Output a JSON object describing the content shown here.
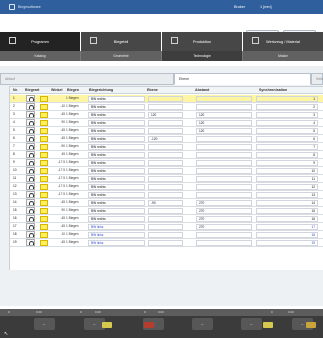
{
  "title": {
    "brand": "Biegesoftware",
    "user": "Bruker",
    "mode": "1 [mm]"
  },
  "modules": [
    {
      "label": "Programm",
      "icon": "program-icon",
      "active": true
    },
    {
      "label": "Biegeteil",
      "icon": "part-icon",
      "active": false
    },
    {
      "label": "Produktion",
      "icon": "production-icon",
      "active": false
    },
    {
      "label": "Werkzeug / Material",
      "icon": "tool-icon",
      "active": false
    }
  ],
  "subtabs": [
    {
      "label": "Katalog",
      "active": false
    },
    {
      "label": "Geometrie",
      "active": false
    },
    {
      "label": "Technologie",
      "active": true
    },
    {
      "label": "Maske",
      "active": false
    }
  ],
  "viewtabs": {
    "left": "Ablauf",
    "middle": "Ebene",
    "right": "Seite"
  },
  "table": {
    "headers": [
      "Nr.",
      "Biegeart",
      "Winkel",
      "Biegen",
      "Biegerichtung",
      "Ebene",
      "Abstand",
      "Synchronisation"
    ],
    "rows": [
      {
        "no": "1",
        "small": "",
        "form": "1 Biegen",
        "edge": "BW rechts",
        "ebene": "",
        "abstand": "",
        "sync": "1",
        "selected": true
      },
      {
        "no": "2",
        "small": "-10",
        "form": "1 Biegen",
        "edge": "BW rechts",
        "ebene": "",
        "abstand": "",
        "sync": "2",
        "selected": false
      },
      {
        "no": "3",
        "small": "-45",
        "form": "1 Biegen",
        "edge": "BW rechts",
        "ebene": "120",
        "abstand": "120",
        "sync": "3",
        "selected": false
      },
      {
        "no": "4",
        "small": "90",
        "form": "1 Biegen",
        "edge": "BW rechts",
        "ebene": "",
        "abstand": "120",
        "sync": "4",
        "selected": false
      },
      {
        "no": "5",
        "small": "-45",
        "form": "1 Biegen",
        "edge": "BW rechts",
        "ebene": "",
        "abstand": "120",
        "sync": "5",
        "selected": false
      },
      {
        "no": "6",
        "small": "-45",
        "form": "1 Biegen",
        "edge": "BW rechts",
        "ebene": "-120",
        "abstand": "",
        "sync": "6",
        "selected": false
      },
      {
        "no": "7",
        "small": "-90",
        "form": "1 Biegen",
        "edge": "BW rechts",
        "ebene": "",
        "abstand": "",
        "sync": "7",
        "selected": false
      },
      {
        "no": "8",
        "small": "45",
        "form": "1 Biegen",
        "edge": "BW rechts",
        "ebene": "",
        "abstand": "",
        "sync": "8",
        "selected": false
      },
      {
        "no": "9",
        "small": "-17.5",
        "form": "1 Biegen",
        "edge": "BW rechts",
        "ebene": "",
        "abstand": "",
        "sync": "9",
        "selected": false
      },
      {
        "no": "10",
        "small": "-17.5",
        "form": "1 Biegen",
        "edge": "BW rechts",
        "ebene": "",
        "abstand": "",
        "sync": "10",
        "selected": false
      },
      {
        "no": "11",
        "small": "-17.5",
        "form": "1 Biegen",
        "edge": "BW rechts",
        "ebene": "",
        "abstand": "",
        "sync": "11",
        "selected": false
      },
      {
        "no": "12",
        "small": "-17.5",
        "form": "1 Biegen",
        "edge": "BW rechts",
        "ebene": "",
        "abstand": "",
        "sync": "12",
        "selected": false
      },
      {
        "no": "13",
        "small": "-17.5",
        "form": "1 Biegen",
        "edge": "BW rechts",
        "ebene": "",
        "abstand": "",
        "sync": "13",
        "selected": false
      },
      {
        "no": "14",
        "small": "-45",
        "form": "1 Biegen",
        "edge": "BW rechts",
        "ebene": "-90",
        "abstand": "270",
        "sync": "14",
        "selected": false
      },
      {
        "no": "15",
        "small": "90",
        "form": "1 Biegen",
        "edge": "BW rechts",
        "ebene": "",
        "abstand": "270",
        "sync": "15",
        "selected": false
      },
      {
        "no": "16",
        "small": "-45",
        "form": "1 Biegen",
        "edge": "BW rechts",
        "ebene": "",
        "abstand": "270",
        "sync": "16",
        "selected": false
      },
      {
        "no": "17",
        "small": "-45",
        "form": "1 Biegen",
        "edge": "BW links",
        "ebene": "",
        "abstand": "270",
        "sync": "17",
        "selected": false
      },
      {
        "no": "18",
        "small": "10",
        "form": "1 Biegen",
        "edge": "BW links",
        "ebene": "",
        "abstand": "",
        "sync": "18",
        "selected": false
      },
      {
        "no": "19",
        "small": "-45",
        "form": "1 Biegen",
        "edge": "BW links",
        "ebene": "",
        "abstand": "",
        "sync": "19",
        "selected": false
      }
    ]
  },
  "status": [
    "0",
    "0.00",
    "0",
    "0.00",
    "0",
    "0.00",
    "0",
    "0.00"
  ],
  "bottom_buttons": [
    "←",
    "←",
    "←",
    "←",
    "←",
    "←"
  ],
  "colors": {
    "header": "#2f5f9c",
    "selected": "#fef5a3",
    "table_blue": "#2f4bc7"
  }
}
